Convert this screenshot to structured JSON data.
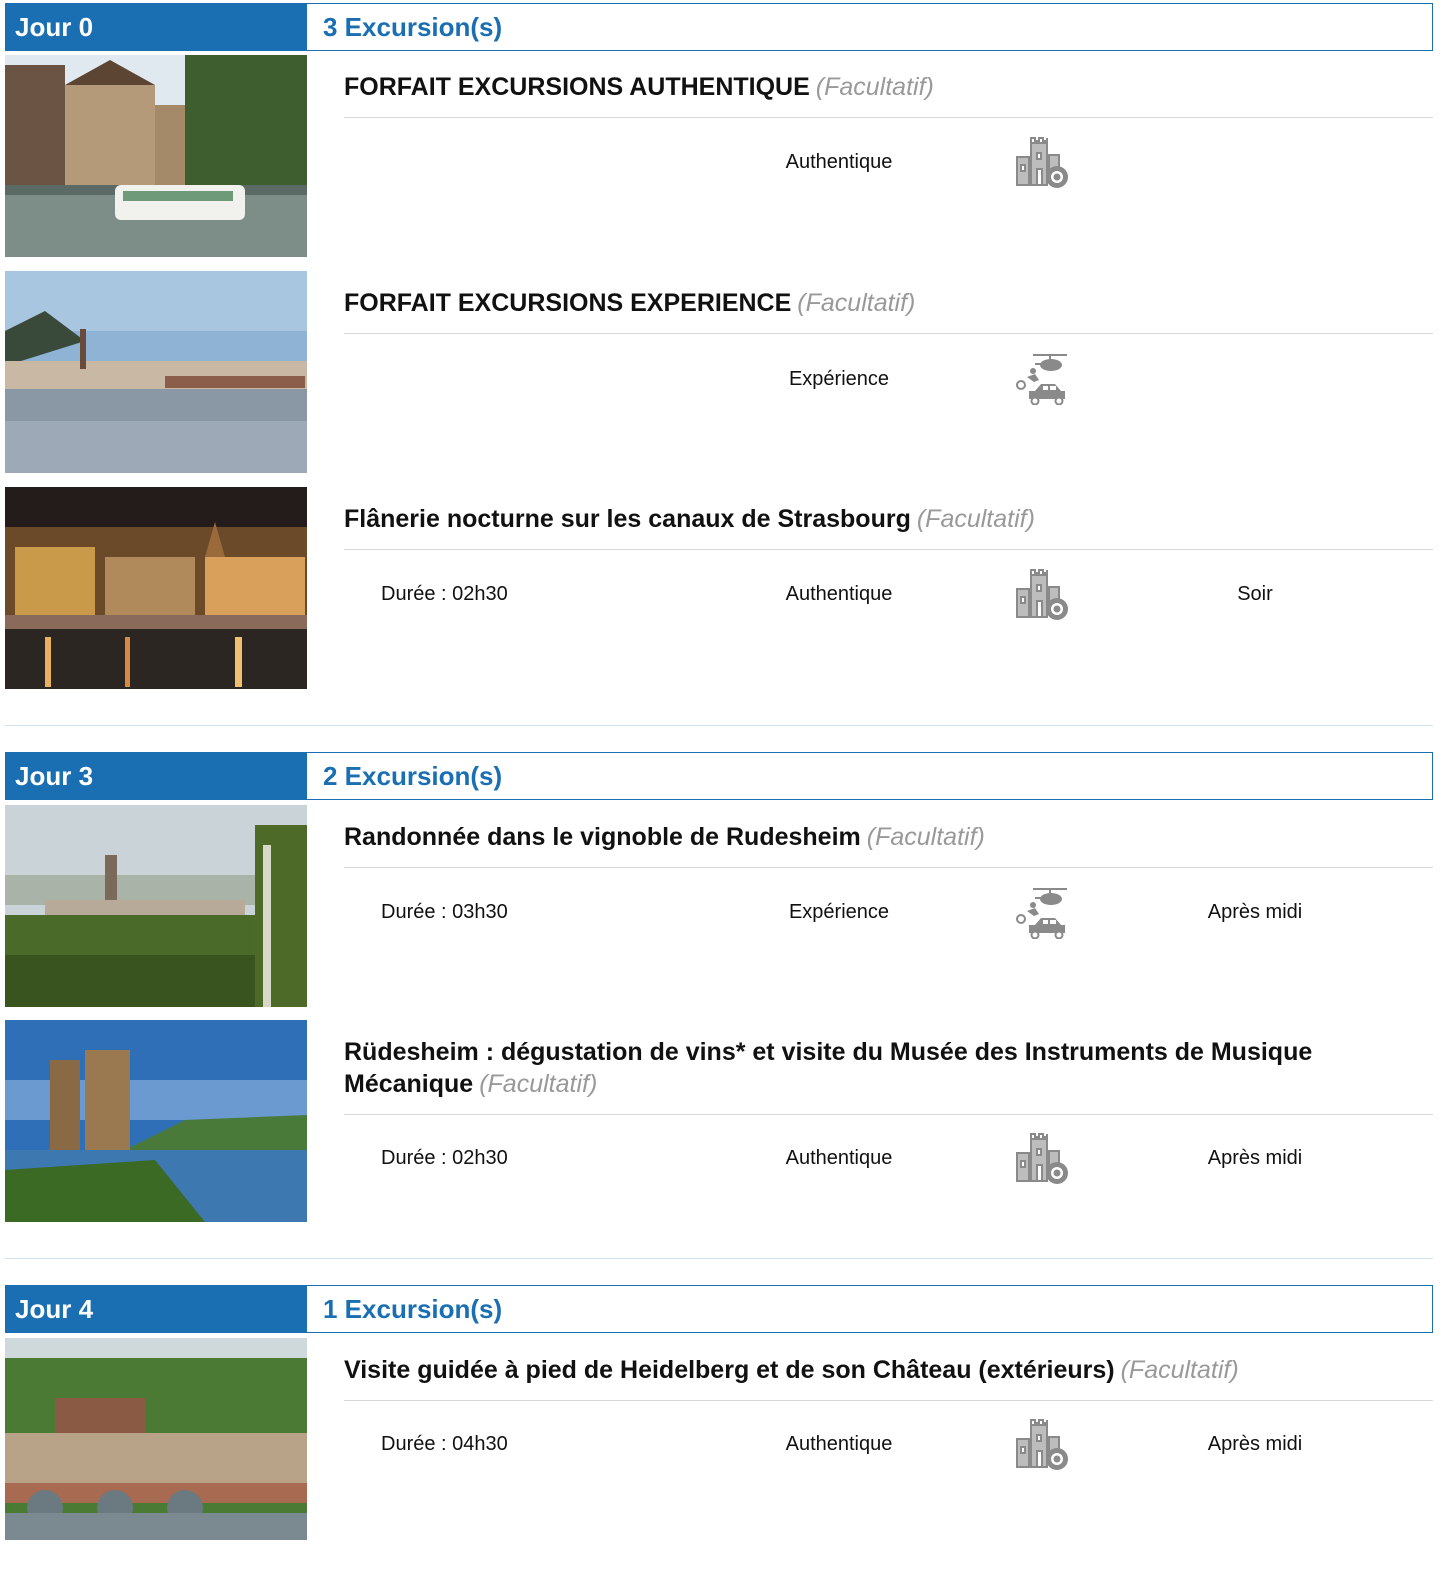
{
  "optional_label": "(Facultatif)",
  "days": [
    {
      "label": "Jour 0",
      "count": "3 Excursion(s)",
      "excursions": [
        {
          "title": "FORFAIT EXCURSIONS AUTHENTIQUE",
          "theme": "Authentique",
          "icon": "castle-camera-icon",
          "image": "strasbourg-canal-boat"
        },
        {
          "title": "FORFAIT EXCURSIONS EXPERIENCE",
          "theme": "Expérience",
          "icon": "helicopter-bike-car-icon",
          "image": "heidelberg-river"
        },
        {
          "title": "Flânerie nocturne sur les canaux de Strasbourg",
          "duration": "Durée : 02h30",
          "theme": "Authentique",
          "icon": "castle-camera-icon",
          "period": "Soir",
          "image": "strasbourg-night"
        }
      ]
    },
    {
      "label": "Jour 3",
      "count": "2 Excursion(s)",
      "excursions": [
        {
          "title": "Randonnée dans le vignoble de Rudesheim",
          "duration": "Durée : 03h30",
          "theme": "Expérience",
          "icon": "helicopter-bike-car-icon",
          "period": "Après midi",
          "image": "rudesheim-vineyard"
        },
        {
          "title": "Rüdesheim : dégustation de vins* et visite du Musée des Instruments de Musique Mécanique",
          "duration": "Durée : 02h30",
          "theme": "Authentique",
          "icon": "castle-camera-icon",
          "period": "Après midi",
          "image": "rhine-tower"
        }
      ]
    },
    {
      "label": "Jour 4",
      "count": "1 Excursion(s)",
      "excursions": [
        {
          "title": "Visite guidée à pied de Heidelberg et de son Château (extérieurs)",
          "duration": "Durée : 04h30",
          "theme": "Authentique",
          "icon": "castle-camera-icon",
          "period": "Après midi",
          "image": "heidelberg-bridge"
        }
      ]
    }
  ],
  "colors": {
    "brand": "#1a6fb3",
    "optional": "#999999",
    "icon": "#8a8a8a"
  }
}
